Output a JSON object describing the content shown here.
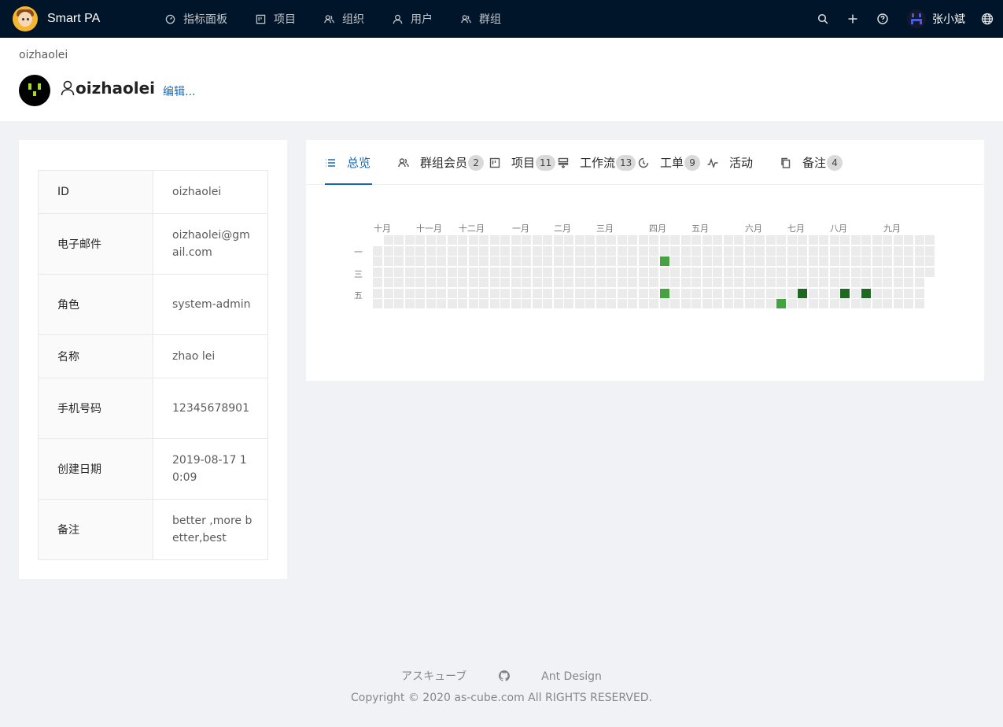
{
  "app": {
    "brand": "Smart PA"
  },
  "nav": {
    "items": [
      {
        "label": "指标面板",
        "icon": "dashboard-icon"
      },
      {
        "label": "项目",
        "icon": "project-icon"
      },
      {
        "label": "组织",
        "icon": "team-icon"
      },
      {
        "label": "用户",
        "icon": "user-icon"
      },
      {
        "label": "群组",
        "icon": "team-icon"
      }
    ]
  },
  "header_right": {
    "username": "张小斌"
  },
  "page": {
    "breadcrumb": "oizhaolei",
    "title": "oizhaolei",
    "edit_label": "编辑..."
  },
  "profile": {
    "rows": [
      {
        "label": "ID",
        "value": "oizhaolei"
      },
      {
        "label": "电子邮件",
        "value": "oizhaolei@gmail.com"
      },
      {
        "label": "角色",
        "value": "system-admin"
      },
      {
        "label": "名称",
        "value": "zhao lei"
      },
      {
        "label": "手机号码",
        "value": "12345678901"
      },
      {
        "label": "创建日期",
        "value": "2019-08-17 10:09"
      },
      {
        "label": "备注",
        "value": "better ,more better,best"
      }
    ]
  },
  "tabs": [
    {
      "label": "总览",
      "badge": null,
      "icon": "list-icon",
      "active": true
    },
    {
      "label": "群组会员",
      "badge": "2",
      "icon": "team-icon",
      "active": false
    },
    {
      "label": "项目",
      "badge": "11",
      "icon": "project-icon",
      "active": false
    },
    {
      "label": "工作流",
      "badge": "13",
      "icon": "workflow-icon",
      "active": false
    },
    {
      "label": "工单",
      "badge": "9",
      "icon": "clock-icon",
      "active": false
    },
    {
      "label": "活动",
      "badge": null,
      "icon": "activity-icon",
      "active": false
    },
    {
      "label": "备注",
      "badge": "4",
      "icon": "copy-icon",
      "active": false
    }
  ],
  "heatmap": {
    "months": [
      "十月",
      "十一月",
      "十二月",
      "一月",
      "二月",
      "三月",
      "四月",
      "五月",
      "六月",
      "七月",
      "八月",
      "九月"
    ],
    "day_labels": [
      "一",
      "三",
      "五"
    ],
    "colors": {
      "empty": "#ebebeb",
      "level1": "#44a340",
      "level2": "#1e6823"
    },
    "active_cells": [
      {
        "week": 27,
        "day": 2,
        "level": 1
      },
      {
        "week": 27,
        "day": 5,
        "level": 1
      },
      {
        "week": 38,
        "day": 6,
        "level": 1
      },
      {
        "week": 40,
        "day": 5,
        "level": 2
      },
      {
        "week": 44,
        "day": 5,
        "level": 2
      },
      {
        "week": 46,
        "day": 5,
        "level": 2
      }
    ]
  },
  "footer": {
    "links": [
      "アスキューブ",
      "Ant Design"
    ],
    "copyright": "Copyright © 2020 as-cube.com All RIGHTS RESERVED."
  }
}
